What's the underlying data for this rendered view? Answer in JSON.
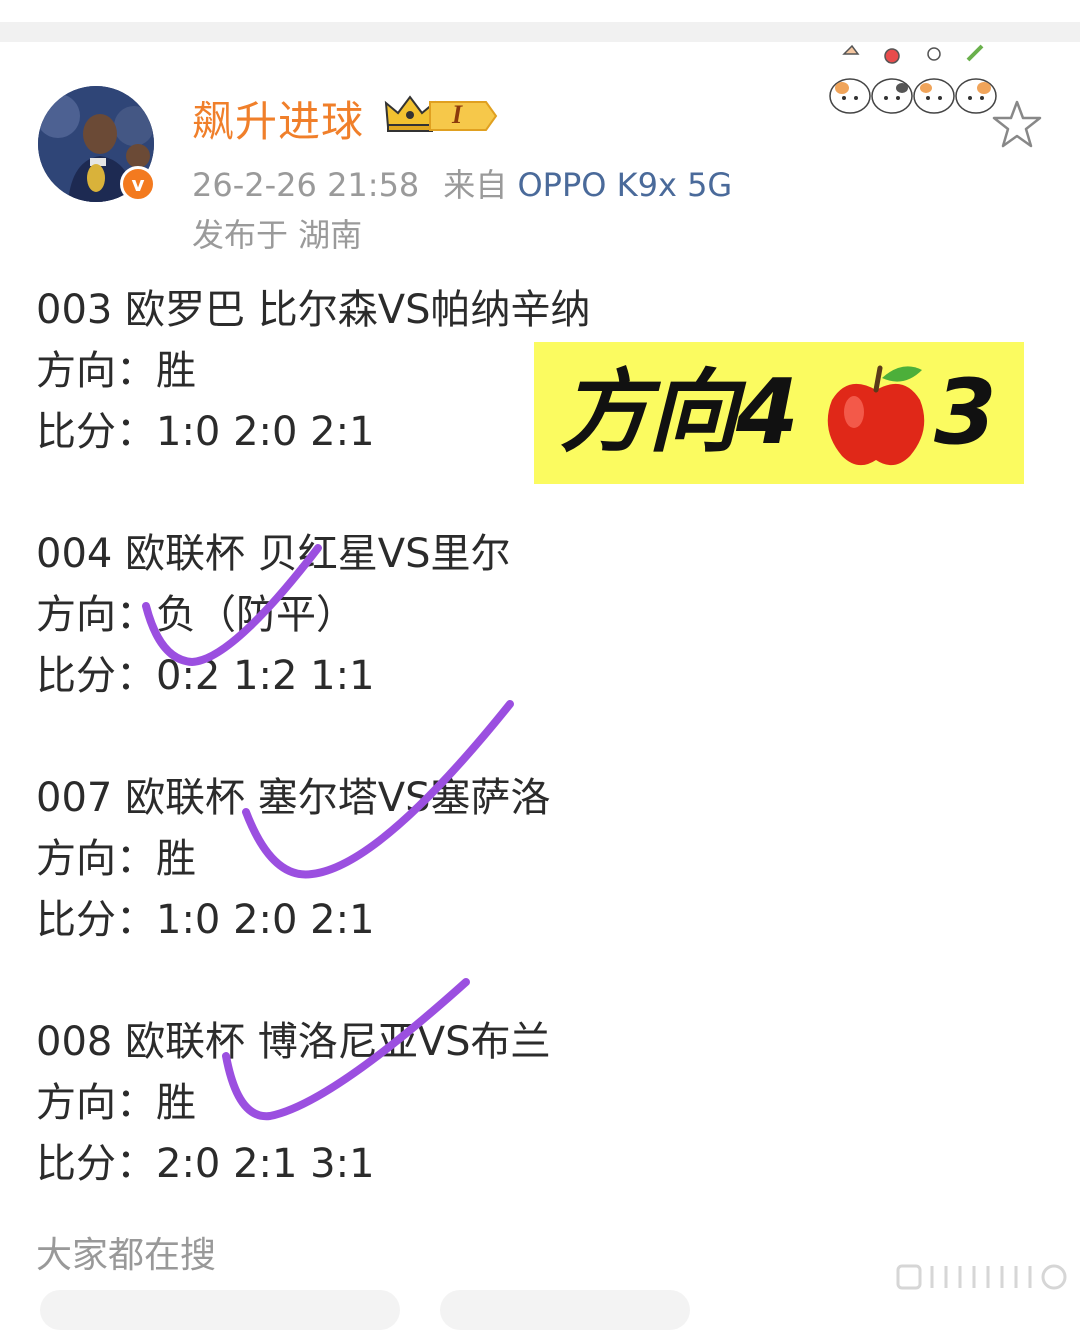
{
  "post": {
    "username": "飙升进球",
    "level_badge": "I",
    "timestamp": "26-2-26 21:58",
    "source_prefix": "来自",
    "device": "OPPO K9x 5G",
    "location": "发布于 湖南"
  },
  "matches": [
    {
      "title": "003 欧罗巴 比尔森VS帕纳辛纳",
      "direction": "方向：胜",
      "score": "比分：1:0 2:0 2:1"
    },
    {
      "title": "004 欧联杯 贝红星VS里尔",
      "direction": "方向：负（防平）",
      "score": "比分：0:2 1:2 1:1"
    },
    {
      "title": "007 欧联杯 塞尔塔VS塞萨洛",
      "direction": "方向：胜",
      "score": "比分：1:0 2:0 2:1"
    },
    {
      "title": "008 欧联杯 博洛尼亚VS布兰",
      "direction": "方向：胜",
      "score": "比分：2:0 2:1 3:1"
    }
  ],
  "highlight": {
    "text": "方向4",
    "emoji": "apple-icon",
    "number": "3"
  },
  "footer": {
    "search_label": "大家都在搜"
  },
  "colors": {
    "username": "#f07f2a",
    "device": "#4a6a9a",
    "meta": "#9a9a9a",
    "highlight_bg": "#fbfb60",
    "check": "#9b4fe0",
    "verified": "#f37a1f"
  }
}
